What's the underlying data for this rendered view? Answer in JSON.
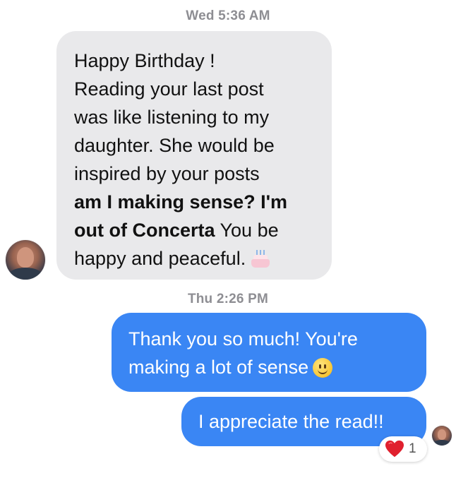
{
  "thread": {
    "timestamp_1": "Wed 5:36 AM",
    "timestamp_2": "Thu 2:26 PM"
  },
  "incoming": {
    "lines": [
      "Happy Birthday !",
      "Reading your last post",
      "was like listening to my",
      "daughter. She would be",
      "inspired by your posts"
    ],
    "bold_1": "am I making sense? I'm",
    "bold_2": "out of Concerta",
    "tail_1": " You be",
    "last_line": "happy and peaceful.",
    "emoji_icon": "birthday-cake-icon",
    "bubble_color": "#e9e9eb"
  },
  "outgoing": {
    "msg1_line1": "Thank you so much! You're",
    "msg1_line2": "making a lot of sense",
    "msg1_emoji_icon": "smiley-face-icon",
    "msg2": "I appreciate the read!!",
    "bubble_color": "#3a86f4"
  },
  "reaction": {
    "icon": "heart-icon",
    "count": "1",
    "color": "#e0202e"
  }
}
